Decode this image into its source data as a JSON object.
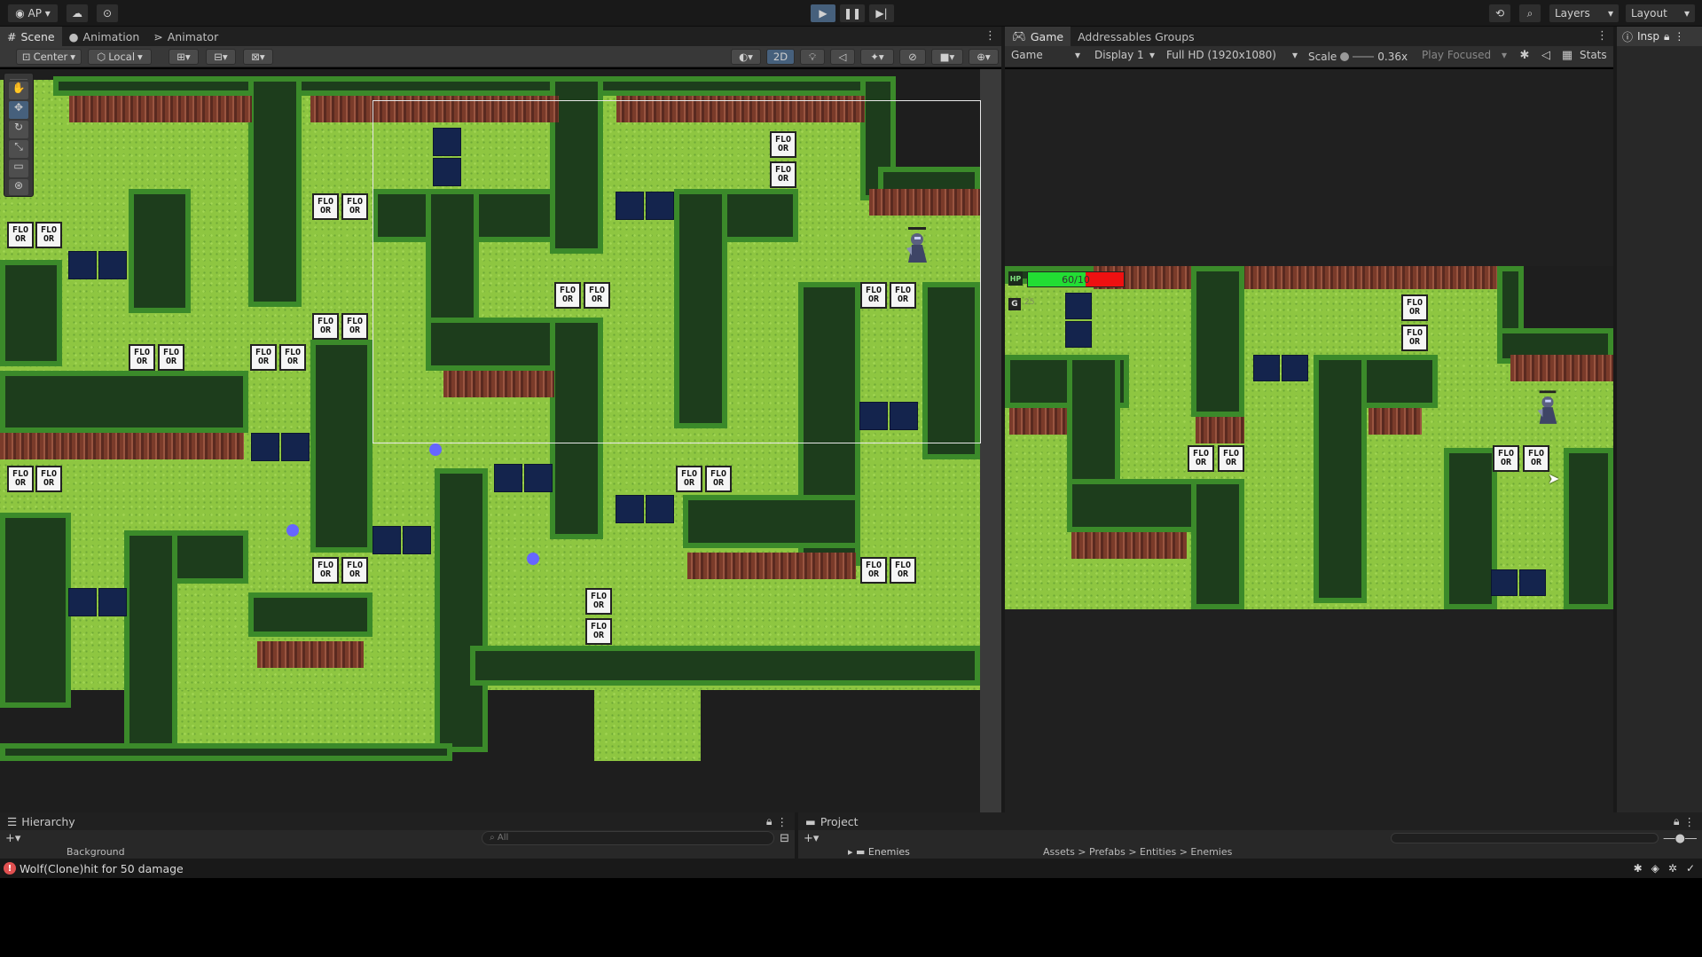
{
  "top_bar": {
    "account": "AP",
    "right": [
      "Layers",
      "Layout"
    ]
  },
  "scene_tabs": [
    "Scene",
    "Animation",
    "Animator"
  ],
  "scene_toolbar": {
    "pivot": "Center",
    "space": "Local",
    "mode_2d": "2D"
  },
  "game_tabs": [
    "Game",
    "Addressables Groups"
  ],
  "game_toolbar": {
    "view": "Game",
    "display": "Display 1",
    "resolution": "Full HD (1920x1080)",
    "scale_label": "Scale",
    "scale_value": "0.36x",
    "play_mode": "Play Focused",
    "stats": "Stats"
  },
  "inspector_tab": "Insp",
  "hud": {
    "hp_label": "HP",
    "hp_text": "60/10",
    "hp_fraction": 0.6,
    "gold_label": "G",
    "gold_value": "25"
  },
  "tile_label": "FLO OR",
  "hierarchy": {
    "title": "Hierarchy",
    "search_placeholder": "All",
    "first_item": "Background"
  },
  "project": {
    "title": "Project",
    "folder": "Enemies",
    "breadcrumb": "Assets > Prefabs > Entities > Enemies"
  },
  "status_message": "Wolf(Clone)hit for 50 damage",
  "colors": {
    "grass": "#8ec641",
    "hedge": "#3b8a2a",
    "tile_dark": "#14244d",
    "hp_green": "#22dd33",
    "hp_red": "#ee1111",
    "accent": "#46607c"
  }
}
